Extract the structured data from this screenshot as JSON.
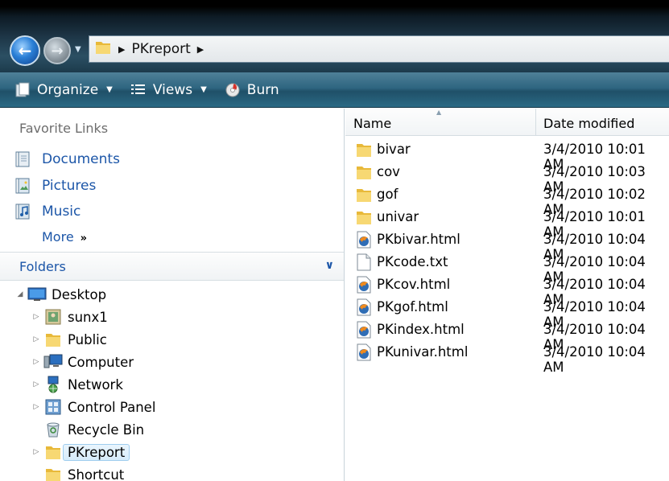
{
  "address": {
    "path": [
      "PKreport"
    ]
  },
  "toolbar": {
    "organize": "Organize",
    "views": "Views",
    "burn": "Burn"
  },
  "favorites": {
    "title": "Favorite Links",
    "items": [
      {
        "label": "Documents",
        "icon": "documents-icon"
      },
      {
        "label": "Pictures",
        "icon": "pictures-icon"
      },
      {
        "label": "Music",
        "icon": "music-icon"
      }
    ],
    "more": "More"
  },
  "folders": {
    "title": "Folders",
    "tree": [
      {
        "label": "Desktop",
        "icon": "desktop-icon"
      },
      {
        "label": "sunx1",
        "icon": "user-folder-icon"
      },
      {
        "label": "Public",
        "icon": "folder-icon"
      },
      {
        "label": "Computer",
        "icon": "computer-icon"
      },
      {
        "label": "Network",
        "icon": "network-icon"
      },
      {
        "label": "Control Panel",
        "icon": "control-panel-icon"
      },
      {
        "label": "Recycle Bin",
        "icon": "recycle-bin-icon"
      },
      {
        "label": "PKreport",
        "icon": "folder-icon",
        "selected": true
      },
      {
        "label": "Shortcut",
        "icon": "folder-icon"
      }
    ]
  },
  "columns": {
    "name": "Name",
    "date_modified": "Date modified"
  },
  "files": [
    {
      "name": "bivar",
      "date": "3/4/2010 10:01 AM",
      "type": "folder"
    },
    {
      "name": "cov",
      "date": "3/4/2010 10:03 AM",
      "type": "folder"
    },
    {
      "name": "gof",
      "date": "3/4/2010 10:02 AM",
      "type": "folder"
    },
    {
      "name": "univar",
      "date": "3/4/2010 10:01 AM",
      "type": "folder"
    },
    {
      "name": "PKbivar.html",
      "date": "3/4/2010 10:04 AM",
      "type": "html"
    },
    {
      "name": "PKcode.txt",
      "date": "3/4/2010 10:04 AM",
      "type": "txt"
    },
    {
      "name": "PKcov.html",
      "date": "3/4/2010 10:04 AM",
      "type": "html"
    },
    {
      "name": "PKgof.html",
      "date": "3/4/2010 10:04 AM",
      "type": "html"
    },
    {
      "name": "PKindex.html",
      "date": "3/4/2010 10:04 AM",
      "type": "html"
    },
    {
      "name": "PKunivar.html",
      "date": "3/4/2010 10:04 AM",
      "type": "html"
    }
  ]
}
